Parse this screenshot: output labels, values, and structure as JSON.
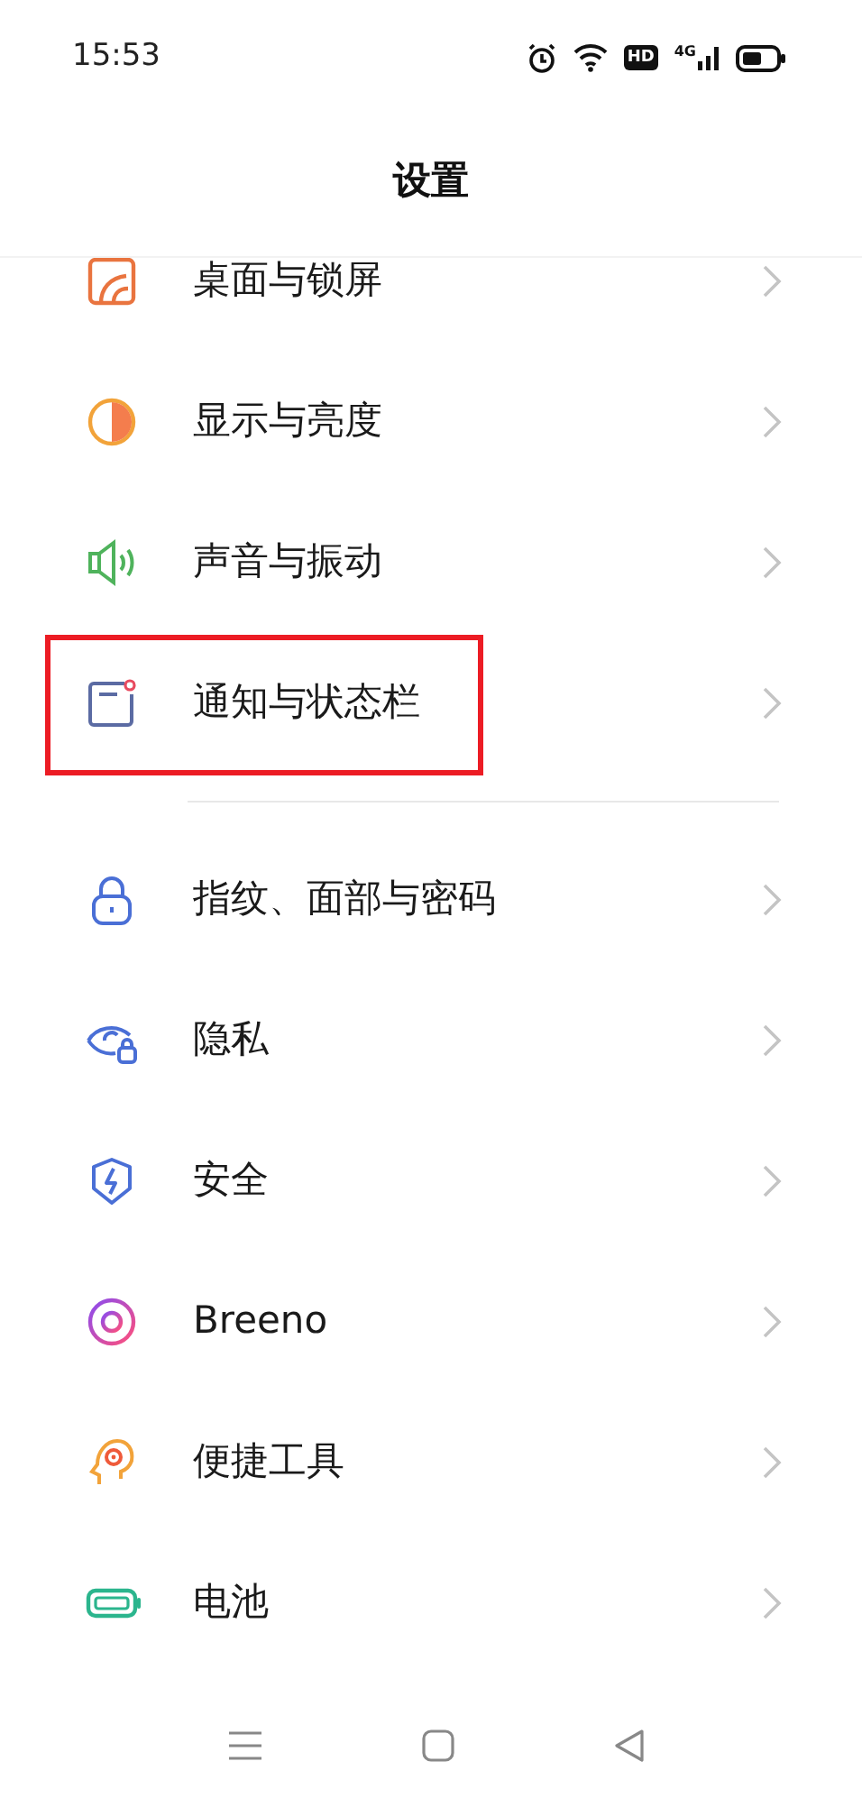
{
  "status_bar": {
    "time": "15:53",
    "hd_badge": "HD",
    "network": "4G"
  },
  "header": {
    "title": "设置"
  },
  "sections": [
    {
      "items": [
        {
          "label": "桌面与锁屏",
          "highlighted": false
        },
        {
          "label": "显示与亮度",
          "highlighted": false
        },
        {
          "label": "声音与振动",
          "highlighted": false
        },
        {
          "label": "通知与状态栏",
          "highlighted": true
        }
      ]
    },
    {
      "items": [
        {
          "label": "指纹、面部与密码",
          "highlighted": false
        },
        {
          "label": "隐私",
          "highlighted": false
        },
        {
          "label": "安全",
          "highlighted": false
        },
        {
          "label": "Breeno",
          "highlighted": false
        },
        {
          "label": "便捷工具",
          "highlighted": false
        },
        {
          "label": "电池",
          "highlighted": false
        }
      ]
    }
  ]
}
